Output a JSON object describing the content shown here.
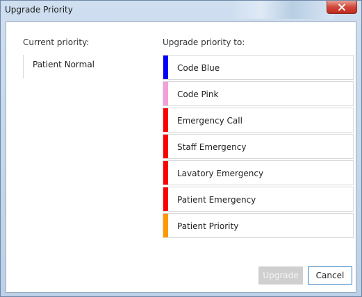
{
  "window": {
    "title": "Upgrade Priority",
    "close_symbol": "close-icon"
  },
  "current": {
    "label": "Current priority:",
    "value": "Patient Normal"
  },
  "upgrade": {
    "label": "Upgrade priority to:",
    "options": [
      {
        "label": "Code Blue",
        "color": "#0000ff"
      },
      {
        "label": "Code Pink",
        "color": "#f2a0d8"
      },
      {
        "label": "Emergency Call",
        "color": "#ff0000"
      },
      {
        "label": "Staff Emergency",
        "color": "#ff0000"
      },
      {
        "label": "Lavatory Emergency",
        "color": "#ff0000"
      },
      {
        "label": "Patient Emergency",
        "color": "#ff0000"
      },
      {
        "label": "Patient Priority",
        "color": "#ff9900"
      }
    ]
  },
  "buttons": {
    "upgrade_label": "Upgrade",
    "cancel_label": "Cancel",
    "upgrade_enabled": false
  }
}
